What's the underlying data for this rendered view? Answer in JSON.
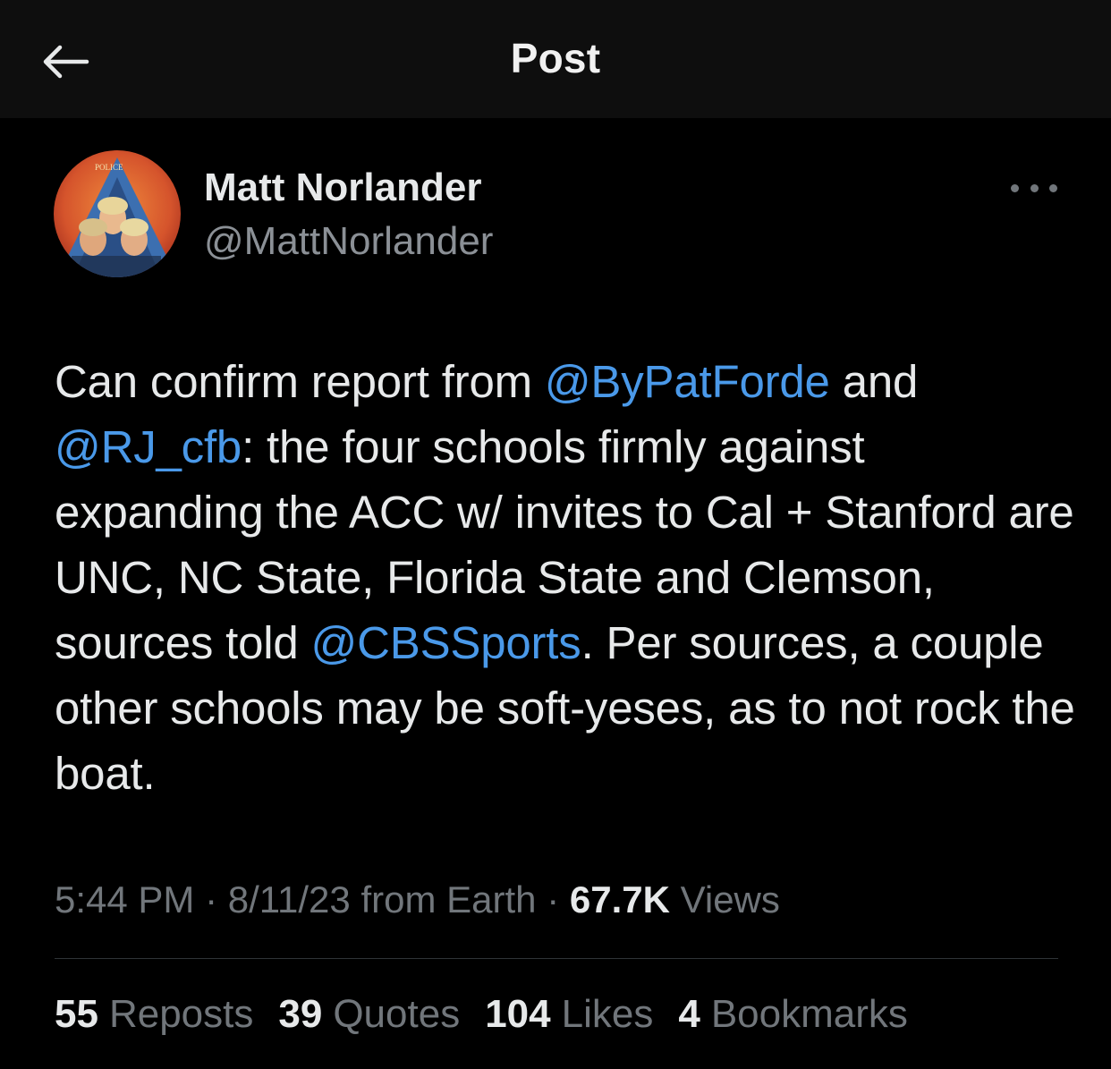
{
  "header": {
    "title": "Post",
    "back_icon": "arrow-left-icon"
  },
  "author": {
    "display_name": "Matt Norlander",
    "handle": "@MattNorlander",
    "avatar_icon": "profile-avatar",
    "avatar_text": "POLICE"
  },
  "more_icon": "ellipsis-icon",
  "tweet": {
    "segments": [
      {
        "type": "text",
        "value": "Can confirm report from "
      },
      {
        "type": "mention",
        "value": "@ByPatForde"
      },
      {
        "type": "text",
        "value": " and "
      },
      {
        "type": "mention",
        "value": "@RJ_cfb"
      },
      {
        "type": "text",
        "value": ": the four schools firmly against expanding the ACC w/ invites to Cal + Stanford are UNC, NC State, Florida State and Clemson, sources told "
      },
      {
        "type": "mention",
        "value": "@CBSSports"
      },
      {
        "type": "text",
        "value": ". Per sources, a couple other schools may be soft-yeses, as to not rock the boat."
      }
    ]
  },
  "meta": {
    "time": "5:44 PM",
    "date": "8/11/23",
    "source": "from Earth",
    "separator": "·",
    "views_count": "67.7K",
    "views_label": "Views"
  },
  "stats": [
    {
      "count": "55",
      "label": "Reposts"
    },
    {
      "count": "39",
      "label": "Quotes"
    },
    {
      "count": "104",
      "label": "Likes"
    },
    {
      "count": "4",
      "label": "Bookmarks"
    }
  ],
  "colors": {
    "background": "#000000",
    "header_bg": "#0e0e0e",
    "text": "#e7e9ea",
    "secondary": "#71767b",
    "mention": "#4a99e9",
    "divider": "#2f3336"
  }
}
